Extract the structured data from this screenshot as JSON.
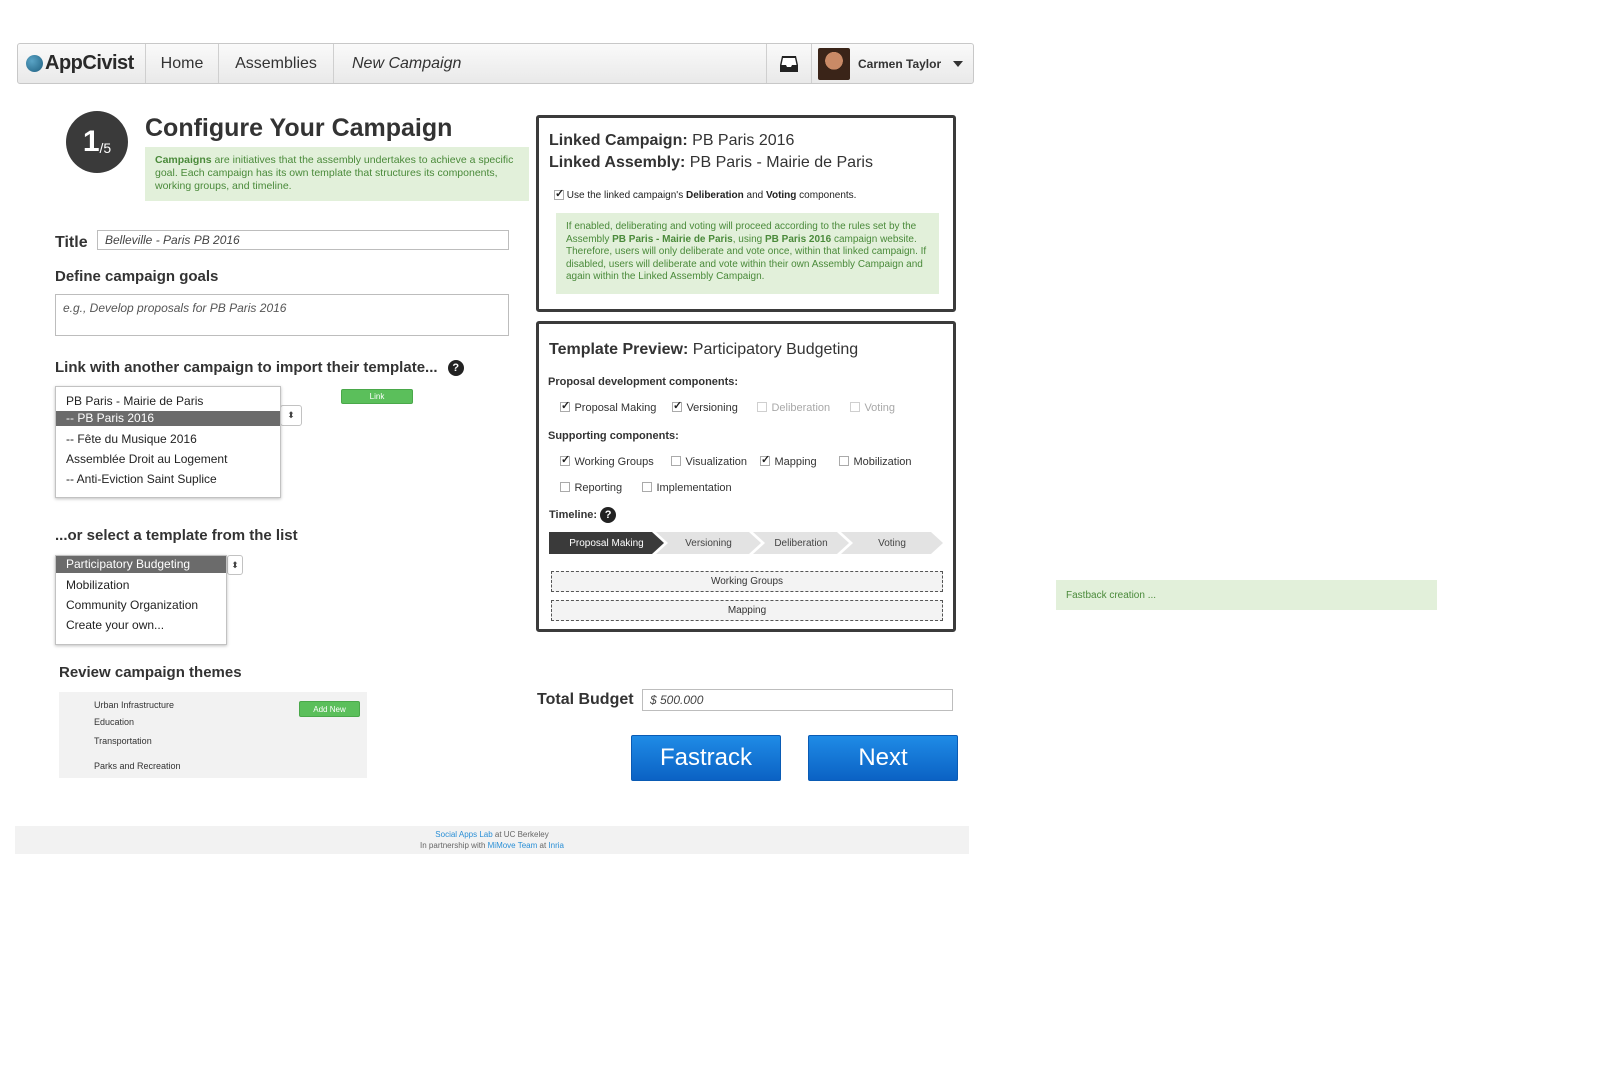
{
  "nav": {
    "brand": "AppCivist",
    "home": "Home",
    "assemblies": "Assemblies",
    "current_page": "New Campaign",
    "user_name": "Carmen Taylor",
    "inbox_icon": "inbox-icon"
  },
  "step": {
    "current": "1",
    "total": "/5"
  },
  "page_title": "Configure Your Campaign",
  "campaign_info": {
    "bold": "Campaigns",
    "text": " are initiatives that the assembly undertakes to achieve a specific goal. Each campaign has its own template that structures its components, working groups, and timeline."
  },
  "title_field": {
    "label": "Title",
    "value": "Belleville - Paris PB 2016"
  },
  "goals": {
    "label": "Define campaign goals",
    "placeholder": "e.g., Develop proposals for PB Paris 2016"
  },
  "link_section": {
    "label": "Link with another campaign to import their template...",
    "button": "Link",
    "options": [
      {
        "label": "PB Paris - Mairie de Paris",
        "selected": false
      },
      {
        "label": "-- PB Paris 2016",
        "selected": true
      },
      {
        "label": "-- Fête du Musique 2016",
        "selected": false
      },
      {
        "label": "Assemblée Droit au Logement",
        "selected": false
      },
      {
        "label": "-- Anti-Eviction Saint Suplice",
        "selected": false
      }
    ]
  },
  "template_section": {
    "label": "...or select a template from the list",
    "options": [
      {
        "label": "Participatory Budgeting",
        "selected": true
      },
      {
        "label": "Mobilization",
        "selected": false
      },
      {
        "label": "Community Organization",
        "selected": false
      },
      {
        "label": "Create your own...",
        "selected": false
      }
    ]
  },
  "themes": {
    "label": "Review campaign themes",
    "add_button": "Add New",
    "items": [
      "Urban Infrastructure",
      "Education",
      "Transportation",
      "Parks and Recreation"
    ]
  },
  "linked_panel": {
    "campaign_label": "Linked Campaign:",
    "campaign_value": "PB Paris 2016",
    "assembly_label": "Linked Assembly:",
    "assembly_value": "PB Paris - Mairie de Paris",
    "checkbox_pre": "Use the linked campaign's ",
    "checkbox_b1": "Deliberation",
    "checkbox_mid": " and ",
    "checkbox_b2": "Voting",
    "checkbox_post": " components.",
    "checkbox_checked": true,
    "info": {
      "t1": "If enabled, deliberating and voting will proceed according to the rules set by the Assembly ",
      "b1": "PB Paris - Mairie de Paris",
      "t2": ", using ",
      "b2": "PB Paris 2016",
      "t3": " campaign website. Therefore, users will only deliberate and vote once, within that linked campaign. If disabled, users will deliberate and vote within their own Assembly Campaign and again within the Linked Assembly Campaign."
    }
  },
  "template_panel": {
    "head_label": "Template Preview:",
    "head_value": "Participatory Budgeting",
    "proposal_head": "Proposal development components:",
    "proposal_components": [
      {
        "label": "Proposal Making",
        "checked": true,
        "enabled": true
      },
      {
        "label": "Versioning",
        "checked": true,
        "enabled": true
      },
      {
        "label": "Deliberation",
        "checked": false,
        "enabled": false
      },
      {
        "label": "Voting",
        "checked": false,
        "enabled": false
      }
    ],
    "supporting_head": "Supporting components:",
    "supporting_components": [
      {
        "label": "Working Groups",
        "checked": true
      },
      {
        "label": "Visualization",
        "checked": false
      },
      {
        "label": "Mapping",
        "checked": true
      },
      {
        "label": "Mobilization",
        "checked": false
      },
      {
        "label": "Reporting",
        "checked": false
      },
      {
        "label": "Implementation",
        "checked": false
      }
    ],
    "timeline_label": "Timeline:",
    "timeline_steps": [
      "Proposal Making",
      "Versioning",
      "Deliberation",
      "Voting"
    ],
    "tracks": [
      "Working Groups",
      "Mapping"
    ]
  },
  "budget": {
    "label": "Total Budget",
    "value": "$ 500.000"
  },
  "buttons": {
    "fastrack": "Fastrack",
    "next": "Next"
  },
  "fastback_message": "Fastback creation ...",
  "footer": {
    "line1_link": "Social Apps Lab",
    "line1_rest": " at UC Berkeley",
    "line2_pre": "In partnership with ",
    "line2_link1": "MiMove Team",
    "line2_mid": " at ",
    "line2_link2": "Inria"
  },
  "colors": {
    "accent_blue": "#0b62c4",
    "success_green": "#5bbf5b",
    "info_green_bg": "#e2f0da",
    "dark": "#3a3a3a"
  }
}
